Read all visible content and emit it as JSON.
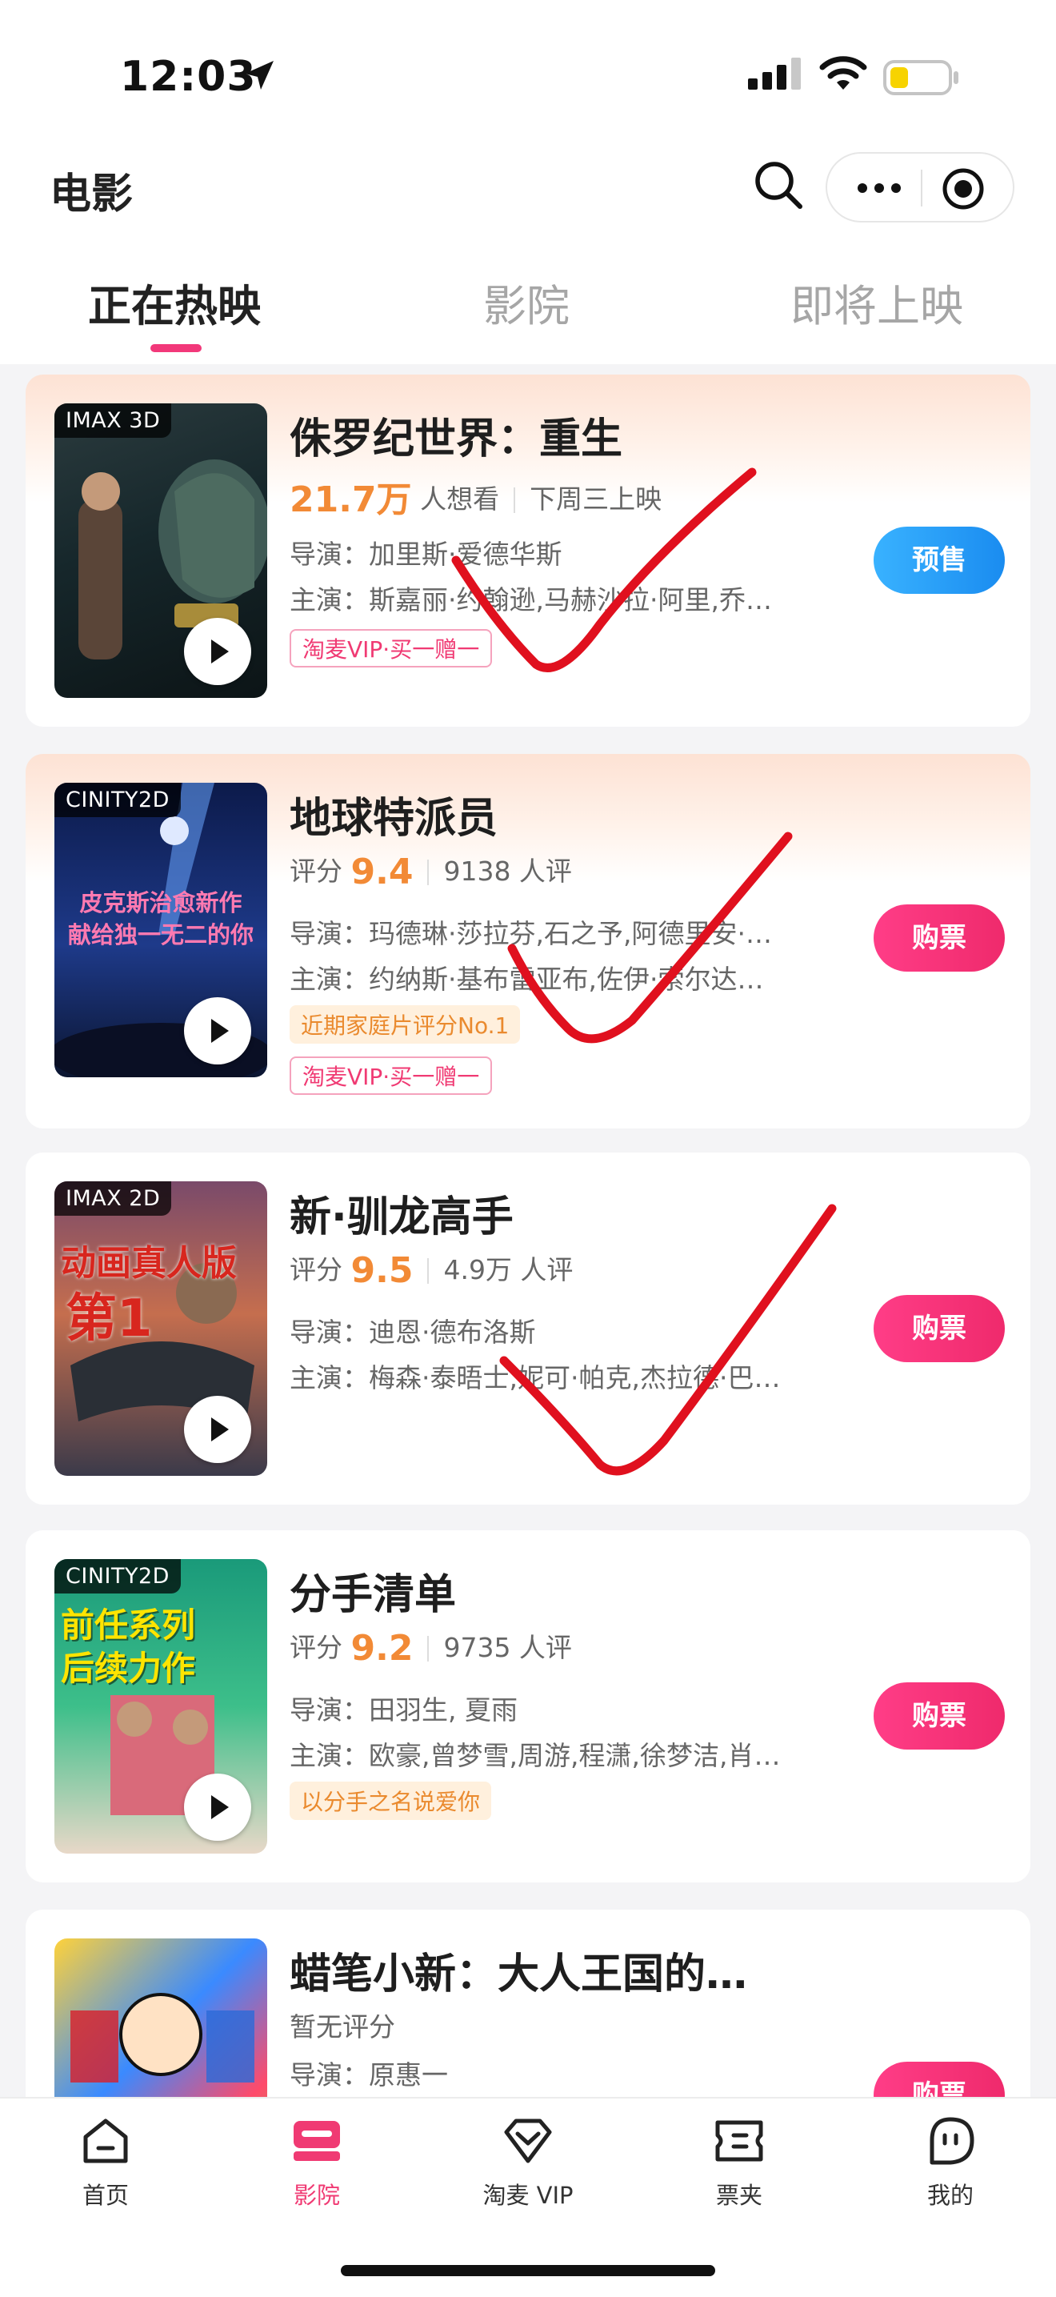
{
  "status_bar": {
    "time": "12:03"
  },
  "header": {
    "title": "电影"
  },
  "tabs": [
    {
      "label": "正在热映",
      "active": true
    },
    {
      "label": "影院",
      "active": false
    },
    {
      "label": "即将上映",
      "active": false
    }
  ],
  "movies": [
    {
      "format": "IMAX 3D",
      "title": "侏罗纪世界：重生",
      "want_count": "21.7万",
      "want_label": "人想看",
      "release_note": "下周三上映",
      "director": "导演：加里斯·爱德华斯",
      "cast": "主演：斯嘉丽·约翰逊,马赫沙拉·阿里,乔…",
      "vip_badge": "淘麦VIP·买一赠一",
      "button": "预售"
    },
    {
      "format": "CINITY2D",
      "title": "地球特派员",
      "score_label": "评分",
      "score": "9.4",
      "review_count": "9138 人评",
      "director": "导演：玛德琳·莎拉芬,石之予,阿德里安·…",
      "cast": "主演：约纳斯·基布雷亚布,佐伊·索尔达…",
      "tag": "近期家庭片评分No.1",
      "vip_badge": "淘麦VIP·买一赠一",
      "button": "购票",
      "poster_text": [
        "皮克斯治愈新作",
        "献给独一无二的你"
      ]
    },
    {
      "format": "IMAX 2D",
      "title": "新·驯龙高手",
      "score_label": "评分",
      "score": "9.5",
      "review_count": "4.9万 人评",
      "director": "导演：迪恩·德布洛斯",
      "cast": "主演：梅森·泰晤士,妮可·帕克,杰拉德·巴…",
      "button": "购票",
      "poster_text": [
        "动画真人版",
        "第1"
      ]
    },
    {
      "format": "CINITY2D",
      "title": "分手清单",
      "score_label": "评分",
      "score": "9.2",
      "review_count": "9735 人评",
      "director": "导演：田羽生, 夏雨",
      "cast": "主演：欧豪,曾梦雪,周游,程潇,徐梦洁,肖…",
      "tag": "以分手之名说爱你",
      "button": "购票",
      "poster_text": [
        "前任系列",
        "后续力作"
      ]
    },
    {
      "title": "蜡笔小新：大人王国的…",
      "score_text": "暂无评分",
      "director": "导演：原惠一",
      "button": "购票"
    }
  ],
  "bottom_nav": [
    {
      "label": "首页",
      "icon": "home-icon"
    },
    {
      "label": "影院",
      "icon": "cinema-icon",
      "active": true
    },
    {
      "label": "淘麦 VIP",
      "icon": "vip-diamond-icon"
    },
    {
      "label": "票夹",
      "icon": "ticket-icon"
    },
    {
      "label": "我的",
      "icon": "profile-icon"
    }
  ],
  "colors": {
    "accent_pink": "#f03a73",
    "presale_blue": "#1a8cf0",
    "score_orange": "#f28a36",
    "check_red": "#e0101e"
  }
}
